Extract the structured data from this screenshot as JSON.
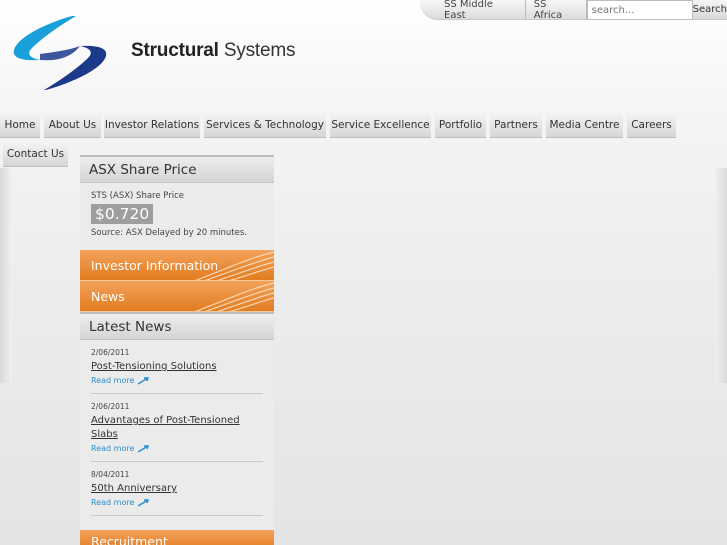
{
  "brand": {
    "name_bold": "Structural",
    "name_regular": "Systems"
  },
  "topbar": {
    "regions": [
      "SS Middle East",
      "SS Africa"
    ],
    "search_placeholder": "search...",
    "search_button": "Search"
  },
  "nav": {
    "items": [
      "Home",
      "About Us",
      "Investor Relations",
      "Services & Technology",
      "Service Excellence",
      "Portfolio",
      "Partners",
      "Media Centre",
      "Careers",
      "Contact Us"
    ]
  },
  "share": {
    "heading": "ASX Share Price",
    "label": "STS (ASX) Share Price",
    "price": "$0.720",
    "source": "Source: ASX Delayed by 20 minutes."
  },
  "links": {
    "investor": "Investor Information",
    "news": "News",
    "recruitment": "Recruitment"
  },
  "latest_news": {
    "heading": "Latest News",
    "read_more": "Read more",
    "items": [
      {
        "date": "2/06/2011",
        "title": "Post-Tensioning Solutions"
      },
      {
        "date": "2/06/2011",
        "title": "Advantages of Post-Tensioned Slabs"
      },
      {
        "date": "8/04/2011",
        "title": "50th Anniversary"
      }
    ]
  },
  "colors": {
    "accent_orange": "#e8862b",
    "logo_cyan": "#1aa0d8",
    "logo_navy": "#1c3a8a",
    "link_blue": "#2a8fd0"
  }
}
